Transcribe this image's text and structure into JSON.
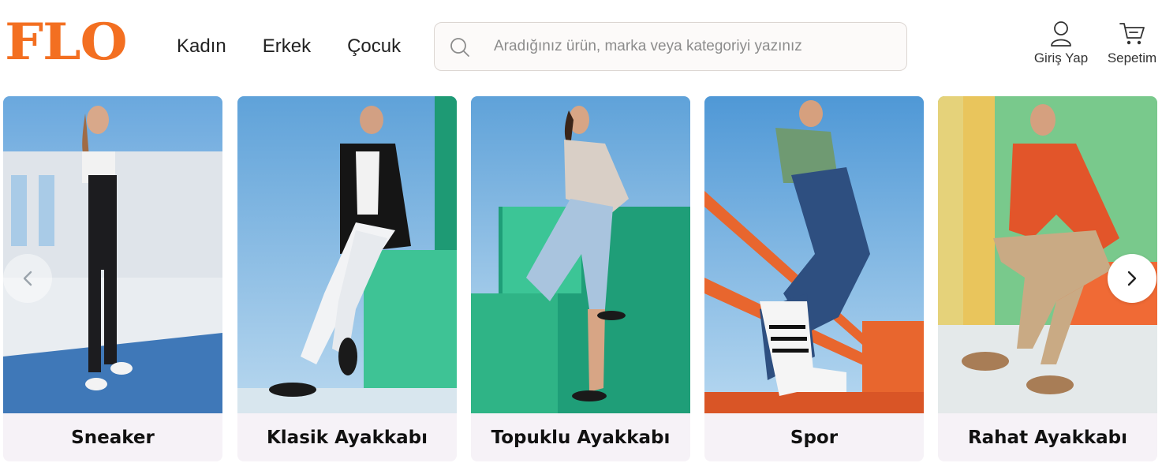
{
  "header": {
    "logo_text": "FLO",
    "nav": [
      {
        "label": "Kadın"
      },
      {
        "label": "Erkek"
      },
      {
        "label": "Çocuk"
      }
    ],
    "search": {
      "placeholder": "Aradığınız ürün, marka veya kategoriyi yazınız",
      "value": ""
    },
    "login_label": "Giriş Yap",
    "cart_label": "Sepetim"
  },
  "categories": [
    {
      "label": "Sneaker"
    },
    {
      "label": "Klasik Ayakkabı"
    },
    {
      "label": "Topuklu Ayakkabı"
    },
    {
      "label": "Spor"
    },
    {
      "label": "Rahat Ayakkabı"
    }
  ],
  "colors": {
    "brand": "#f36f21",
    "text": "#222222",
    "card_label_bg": "#f6f2f7"
  },
  "icons": {
    "search": "search-icon",
    "user": "user-icon",
    "cart": "cart-icon",
    "prev": "chevron-left-icon",
    "next": "chevron-right-icon"
  }
}
